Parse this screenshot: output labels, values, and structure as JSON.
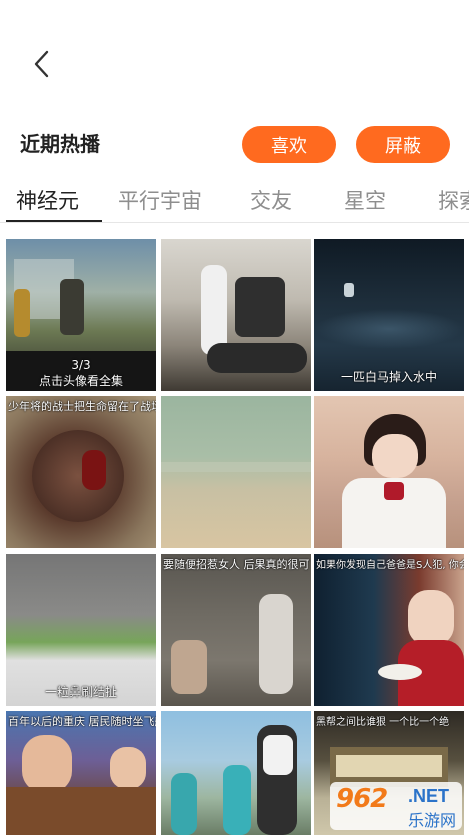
{
  "header": {
    "back_icon": "chevron-left-icon"
  },
  "section": {
    "title": "近期热播",
    "like_label": "喜欢",
    "block_label": "屏蔽",
    "accent_color": "#ff6a1f"
  },
  "tabs": [
    {
      "label": "神经元",
      "active": true
    },
    {
      "label": "平行宇宙",
      "active": false
    },
    {
      "label": "交友",
      "active": false
    },
    {
      "label": "星空",
      "active": false
    },
    {
      "label": "探索",
      "active": false
    }
  ],
  "videos": [
    {
      "caption": "3/3\n点击头像看全集"
    },
    {
      "caption": ""
    },
    {
      "caption": "一匹白马掉入水中"
    },
    {
      "caption": "少年将的战士把生命留在了战场"
    },
    {
      "caption": ""
    },
    {
      "caption": ""
    },
    {
      "caption": "一粒鼻刷结扯"
    },
    {
      "caption": "要随便招惹女人  后果真的很可"
    },
    {
      "caption": "如果你发现自己爸爸是S人犯, 你会怎么"
    },
    {
      "caption": "百年以后的重庆 居民随时坐飞船出"
    },
    {
      "caption": ""
    },
    {
      "caption": "黑帮之间比谁狠 一个比一个绝"
    }
  ],
  "watermark": {
    "logo": "962",
    "net": ".NET",
    "site": "乐游网"
  }
}
